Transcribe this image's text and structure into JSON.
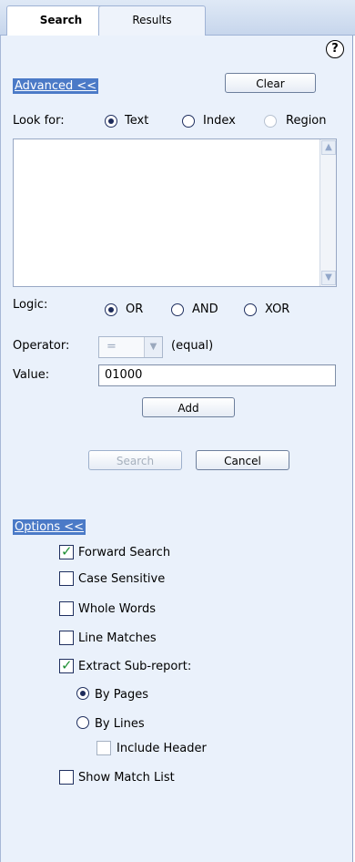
{
  "tabs": {
    "search": "Search",
    "results": "Results"
  },
  "help_label": "?",
  "advanced": {
    "toggle": "Advanced <<",
    "clear": "Clear",
    "look_for": "Look for:",
    "opt_text": "Text",
    "opt_index": "Index",
    "opt_region": "Region",
    "logic": "Logic:",
    "opt_or": "OR",
    "opt_and": "AND",
    "opt_xor": "XOR",
    "operator": "Operator:",
    "operator_value": "=",
    "operator_desc": "(equal)",
    "value": "Value:",
    "value_input": "01000",
    "add": "Add",
    "search": "Search",
    "cancel": "Cancel"
  },
  "options": {
    "toggle": "Options <<",
    "forward_search": "Forward Search",
    "case_sensitive": "Case Sensitive",
    "whole_words": "Whole Words",
    "line_matches": "Line Matches",
    "extract_subreport": "Extract Sub-report:",
    "by_pages": "By Pages",
    "by_lines": "By Lines",
    "include_header": "Include Header",
    "show_match_list": "Show Match List"
  }
}
